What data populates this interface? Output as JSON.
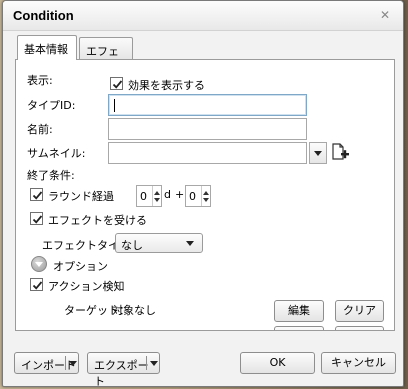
{
  "window": {
    "title": "Condition",
    "close_glyph": "✕"
  },
  "tabs": [
    {
      "label": "基本情報",
      "active": true
    },
    {
      "label": "エフェクト",
      "active": false
    }
  ],
  "form": {
    "display_label": "表示:",
    "show_effect_label": "効果を表示する",
    "show_effect_checked": true,
    "type_id_label": "タイプID:",
    "type_id_value": "",
    "name_label": "名前:",
    "name_value": "",
    "thumbnail_label": "サムネイル:",
    "thumbnail_value": "",
    "end_condition_label": "終了条件:",
    "round_label": "ラウンド経過",
    "round_checked": true,
    "round_value_a": "0",
    "round_unit": "d",
    "round_plus": "+",
    "round_value_b": "0",
    "receive_effect_label": "エフェクトを受ける",
    "receive_effect_checked": true,
    "effect_type_label": "エフェクトタイプ：",
    "effect_type_value": "なし",
    "options_label": "オプション",
    "action_detect_label": "アクション検知",
    "action_detect_checked": true,
    "target_label": "ターゲット：",
    "target_value": "対象なし",
    "edit_button": "編集",
    "clear_button": "クリア"
  },
  "footer": {
    "import_label": "インポート",
    "export_label": "エクスポート",
    "ok_label": "OK",
    "cancel_label": "キャンセル"
  },
  "icons": {
    "close": "close-icon",
    "add_file": "add-file-icon",
    "check": "check-icon",
    "expander": "chevron-down-icon"
  }
}
